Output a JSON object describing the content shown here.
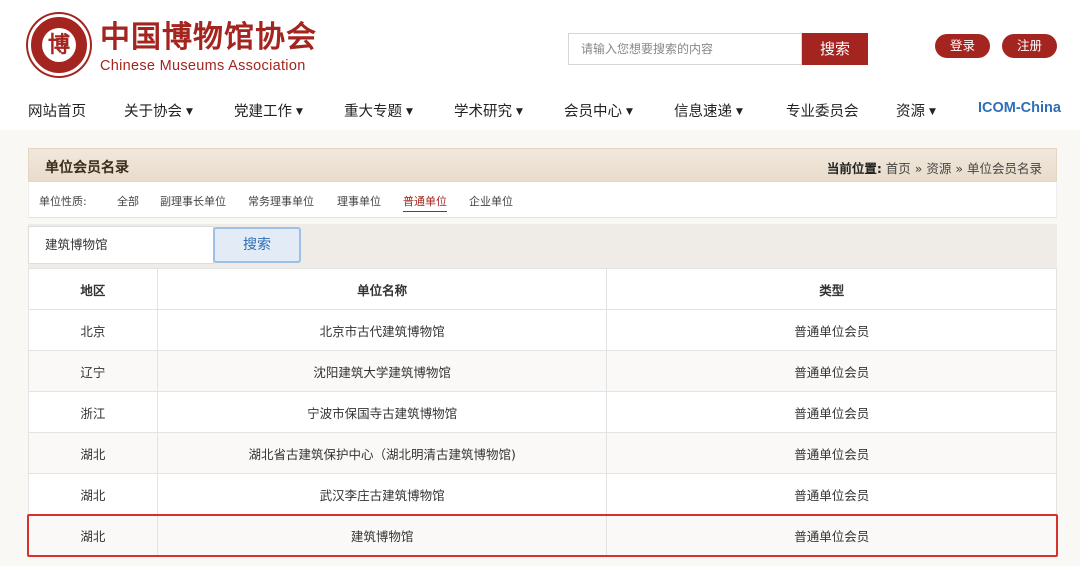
{
  "header": {
    "logo_char": "博",
    "logo_cn": "中国博物馆协会",
    "logo_en": "Chinese Museums Association",
    "search_placeholder": "请输入您想要搜索的内容",
    "search_button": "搜索",
    "login": "登录",
    "register": "注册"
  },
  "nav": [
    {
      "label": "网站首页",
      "caret": false
    },
    {
      "label": "关于协会",
      "caret": true
    },
    {
      "label": "党建工作",
      "caret": true
    },
    {
      "label": "重大专题",
      "caret": true
    },
    {
      "label": "学术研究",
      "caret": true
    },
    {
      "label": "会员中心",
      "caret": true
    },
    {
      "label": "信息速递",
      "caret": true
    },
    {
      "label": "专业委员会",
      "caret": false
    },
    {
      "label": "资源",
      "caret": true
    },
    {
      "label": "ICOM-China",
      "caret": false
    }
  ],
  "caret_glyph": "▼",
  "panel": {
    "title": "单位会员名录",
    "breadcrumb_label": "当前位置:",
    "breadcrumb": "首页 » 资源 » 单位会员名录"
  },
  "filter": {
    "label": "单位性质:",
    "options": [
      "全部",
      "副理事长单位",
      "常务理事单位",
      "理事单位",
      "普通单位",
      "企业单位"
    ],
    "active": "普通单位"
  },
  "search": {
    "value": "建筑博物馆",
    "button": "搜索"
  },
  "table": {
    "headers": [
      "地区",
      "单位名称",
      "类型"
    ],
    "rows": [
      [
        "北京",
        "北京市古代建筑博物馆",
        "普通单位会员"
      ],
      [
        "辽宁",
        "沈阳建筑大学建筑博物馆",
        "普通单位会员"
      ],
      [
        "浙江",
        "宁波市保国寺古建筑博物馆",
        "普通单位会员"
      ],
      [
        "湖北",
        "湖北省古建筑保护中心（湖北明清古建筑博物馆)",
        "普通单位会员"
      ],
      [
        "湖北",
        "武汉李庄古建筑博物馆",
        "普通单位会员"
      ],
      [
        "湖北",
        "建筑博物馆",
        "普通单位会员"
      ]
    ]
  },
  "colors": {
    "brand": "#a4251f",
    "link_blue": "#2e6fb8",
    "highlight": "#d6322b"
  }
}
